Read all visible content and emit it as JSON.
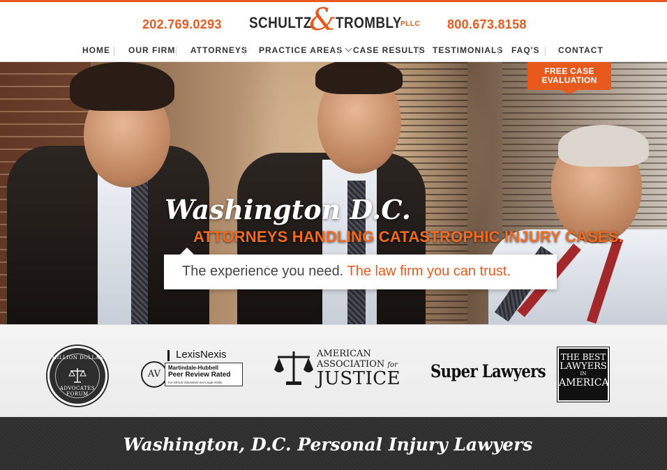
{
  "header": {
    "phone_left": "202.769.0293",
    "phone_right": "800.673.8158",
    "logo": {
      "word1": "SCHULTZ",
      "ampersand": "&",
      "word2": "TROMBLY",
      "suffix": "PLLC"
    }
  },
  "nav": {
    "items": [
      {
        "label": "HOME"
      },
      {
        "label": "OUR FIRM"
      },
      {
        "label": "ATTORNEYS"
      },
      {
        "label": "PRACTICE AREAS",
        "has_dropdown": true
      },
      {
        "label": "CASE RESULTS"
      },
      {
        "label": "TESTIMONIALS"
      },
      {
        "label": "FAQ'S"
      },
      {
        "label": "CONTACT"
      }
    ]
  },
  "hero": {
    "cta": {
      "line1": "FREE CASE",
      "line2": "EVALUATION"
    },
    "title": "Washington D.C.",
    "subtitle": "ATTORNEYS HANDLING CATASTROPHIC INJURY CASES.",
    "tagline_part1": "The experience you need.",
    "tagline_part2": "The law firm you can trust."
  },
  "awards": {
    "million_dollar": {
      "top": "MILLION DOLLAR",
      "bottom": "ADVOCATES FORUM"
    },
    "lexisnexis": {
      "brand": "LexisNexis",
      "badge": "AV",
      "line1": "Martindale-Hubbell",
      "line2": "Peer Review Rated",
      "line3": "For Ethical Standards and Legal Ability"
    },
    "aaj": {
      "line1": "AMERICAN",
      "line2_main": "ASSOCIATION ",
      "line2_for": "for",
      "line3": "JUSTICE"
    },
    "super_lawyers": "Super Lawyers",
    "best_lawyers": {
      "line1": "THE BEST",
      "line2": "LAWYERS",
      "line3": "IN",
      "line4": "AMERICA"
    }
  },
  "band": {
    "title": "Washington, D.C. Personal Injury Lawyers"
  },
  "colors": {
    "accent": "#e8591d",
    "text_dark": "#333333",
    "band_bg": "#2e2e2e"
  }
}
